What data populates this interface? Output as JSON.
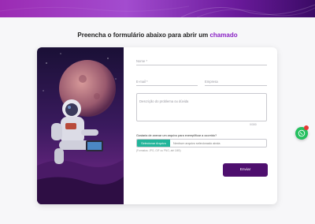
{
  "header": {
    "title_main": "Preencha o formulário abaixo para abrir um",
    "title_accent": "chamado"
  },
  "form": {
    "name_placeholder": "Nome *",
    "email_placeholder": "E-mail *",
    "company_placeholder": "Empresa",
    "description_placeholder": "Descrição do problema ou dúvida",
    "char_counter": "0/300",
    "upload_question": "Gostaria de anexar um arquivo para exemplificar a ocorrido?",
    "file_button_label": "Selecionar Arquivo",
    "file_status": "Nenhum arquivo selecionado ainda",
    "file_hint": "(Formatos: JPG, GIF ou PNG, até 1MB)",
    "submit_label": "Enviar"
  },
  "colors": {
    "accent": "#8a22c5",
    "submit_bg": "#4e0f6e",
    "file_button_bg": "#22b59a",
    "whatsapp_bg": "#25c060"
  },
  "icons": {
    "floating": "whatsapp-icon"
  }
}
